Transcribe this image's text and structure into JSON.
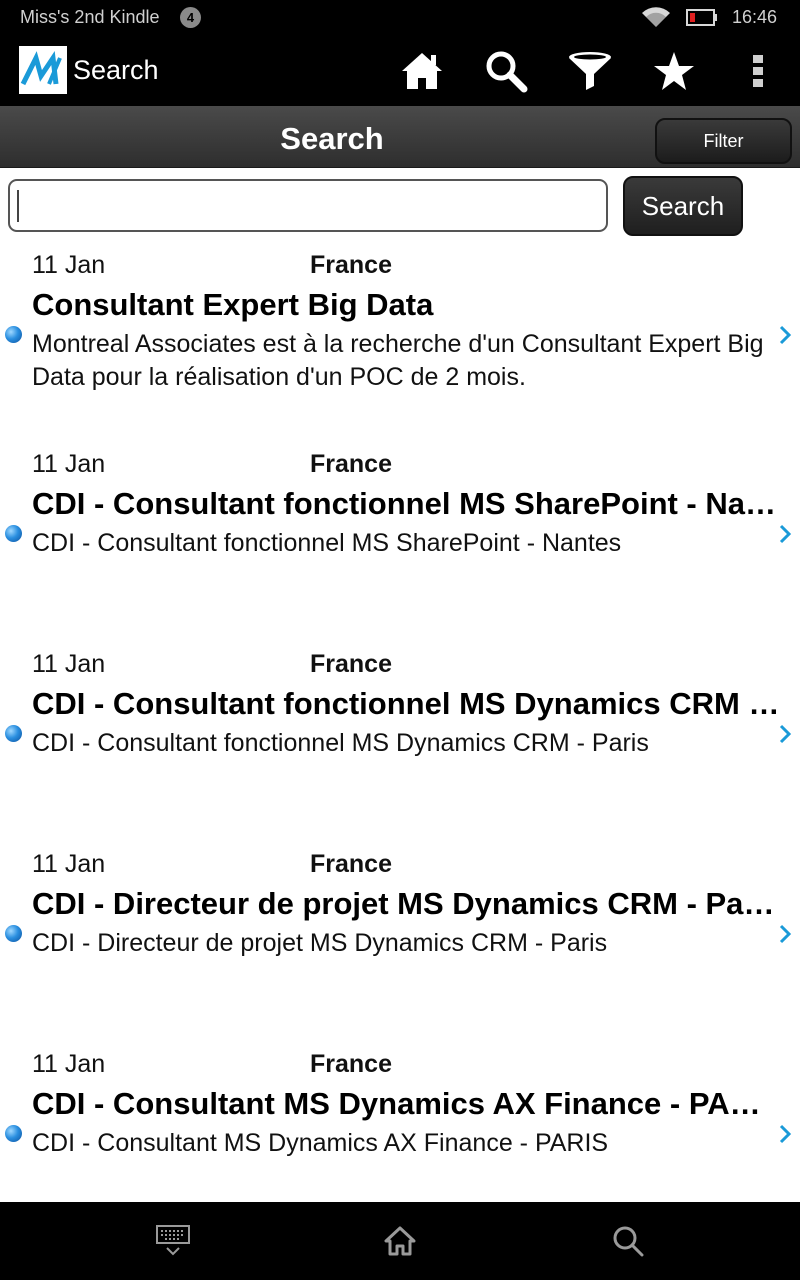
{
  "status_bar": {
    "device_name": "Miss's 2nd Kindle",
    "notification_count": "4",
    "time": "16:46",
    "icons": [
      "wifi-icon",
      "battery-low-icon"
    ]
  },
  "action_bar": {
    "logo_icon": "montreal-associates-logo",
    "title": "Search",
    "actions": [
      "home-icon",
      "search-icon",
      "filter-icon",
      "star-icon",
      "overflow-menu-icon"
    ]
  },
  "header": {
    "title": "Search",
    "filter_label": "Filter"
  },
  "search": {
    "value": "",
    "placeholder": "",
    "button_label": "Search"
  },
  "results": [
    {
      "date": "11 Jan",
      "country": "France",
      "title": "Consultant Expert Big Data",
      "description": "Montreal Associates est à la recherche d'un Consultant Expert Big Data pour la réalisation d'un POC de 2 mois."
    },
    {
      "date": "11 Jan",
      "country": "France",
      "title": "CDI - Consultant fonctionnel MS SharePoint - Nantes",
      "description": "CDI - Consultant fonctionnel MS SharePoint - Nantes"
    },
    {
      "date": "11 Jan",
      "country": "France",
      "title": "CDI - Consultant fonctionnel MS Dynamics CRM - Paris",
      "description": "CDI - Consultant fonctionnel MS Dynamics CRM - Paris"
    },
    {
      "date": "11 Jan",
      "country": "France",
      "title": "CDI - Directeur de projet MS Dynamics CRM - Paris",
      "description": "CDI - Directeur de projet MS Dynamics CRM - Paris"
    },
    {
      "date": "11 Jan",
      "country": "France",
      "title": "CDI - Consultant MS Dynamics AX Finance - PARIS",
      "description": "CDI - Consultant MS Dynamics AX Finance - PARIS"
    }
  ],
  "bottom_nav": [
    "keyboard-icon",
    "home-icon",
    "search-icon"
  ],
  "colors": {
    "bar_background": "#000000",
    "header_background": "#3a3a3a",
    "logo_blue": "#1a9ad8",
    "chevron_blue": "#1a9ad8",
    "text": "#000000"
  }
}
